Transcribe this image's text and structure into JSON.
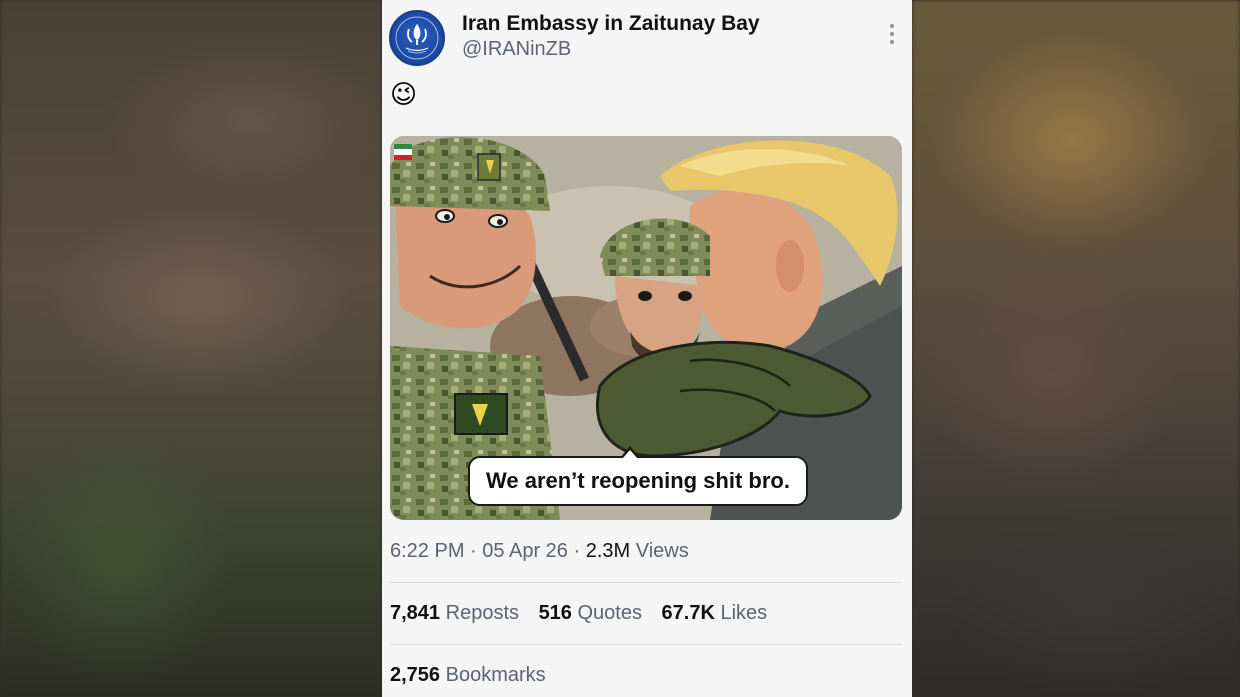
{
  "account": {
    "display_name": "Iran Embassy in Zaitunay Bay",
    "handle": "@IRANinZB",
    "avatar_icon": "iran-emblem-icon",
    "avatar_color": "#1d4aa3"
  },
  "post": {
    "text_emoji": "😉",
    "image_caption": "We aren’t reopening shit bro.",
    "time": "6:22 PM",
    "date": "05 Apr 26",
    "views_count": "2.3M",
    "views_label": "Views",
    "separator": "·"
  },
  "stats": {
    "reposts_count": "7,841",
    "reposts_label": "Reposts",
    "quotes_count": "516",
    "quotes_label": "Quotes",
    "likes_count": "67.7K",
    "likes_label": "Likes",
    "bookmarks_count": "2,756",
    "bookmarks_label": "Bookmarks"
  },
  "colors": {
    "card_bg": "#f5f5f6",
    "primary_text": "#111111",
    "secondary_text": "#5c6470"
  }
}
